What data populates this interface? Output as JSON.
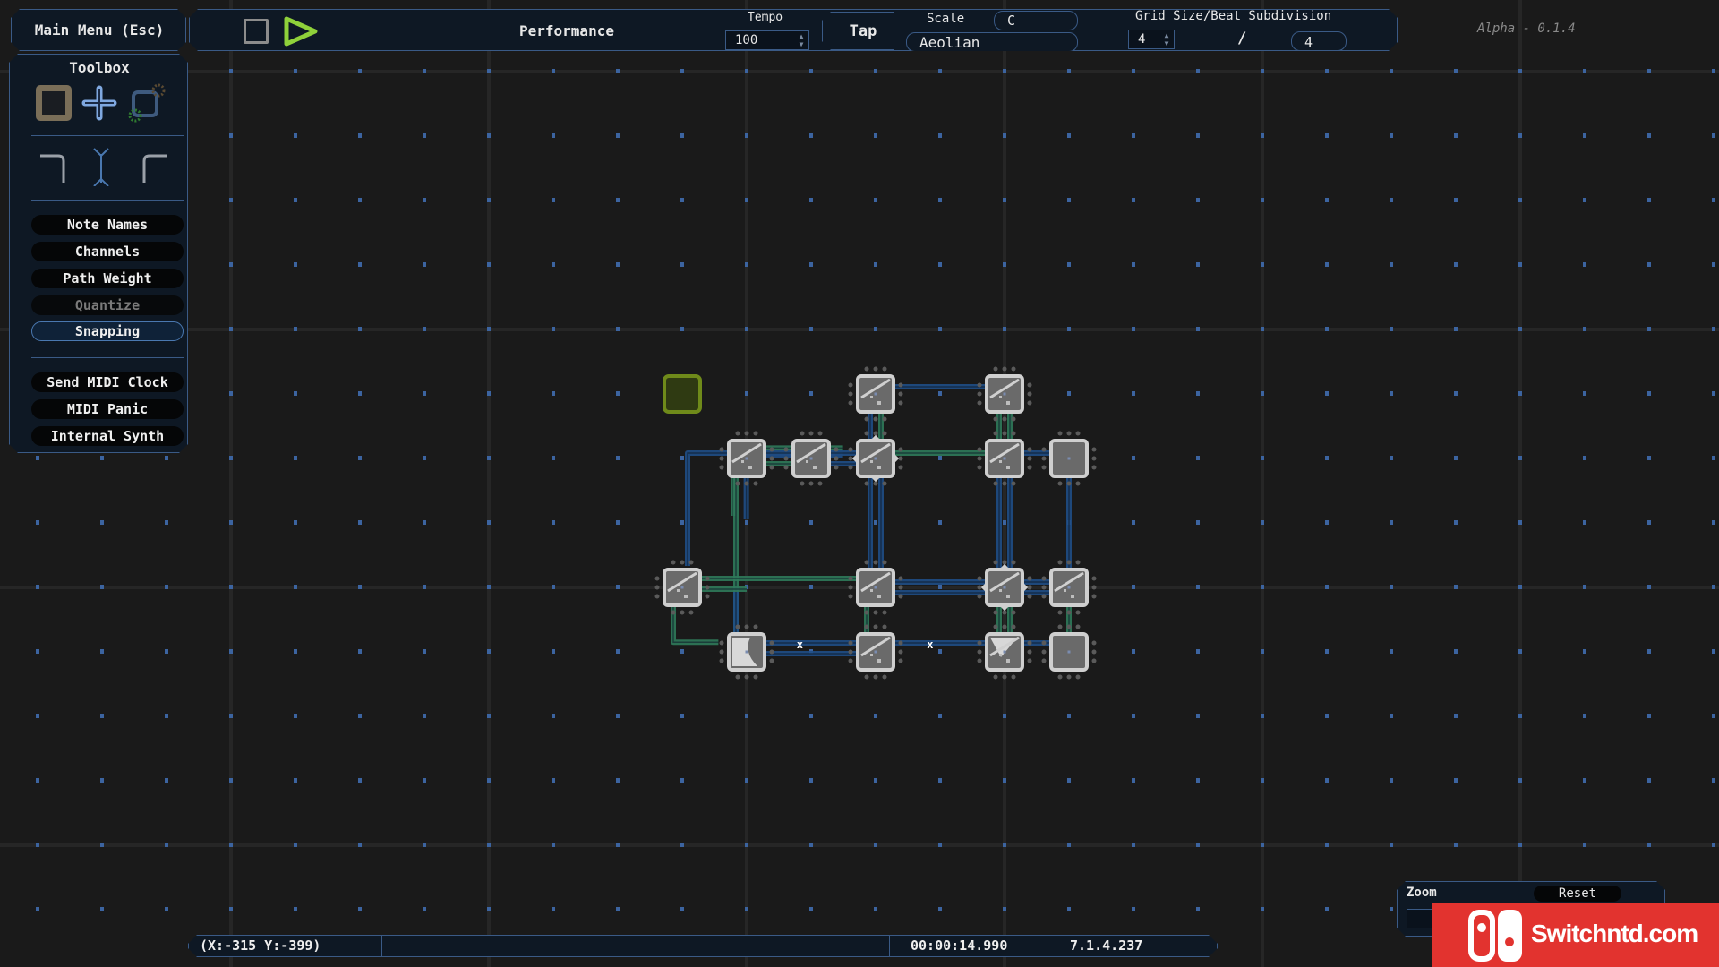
{
  "app": {
    "version_label": "Alpha - 0.1.4"
  },
  "main_menu": {
    "label": "Main Menu (Esc)"
  },
  "toolbar": {
    "stop_icon": "stop-square-icon",
    "play_icon": "play-triangle-icon",
    "mode_label": "Performance",
    "tempo": {
      "label": "Tempo",
      "value": "100"
    },
    "tap_label": "Tap",
    "scale": {
      "label": "Scale",
      "root": "C",
      "mode": "Aeolian"
    },
    "grid": {
      "label": "Grid Size/Beat Subdivision",
      "size": "4",
      "divider": "/",
      "subdivision": "4"
    }
  },
  "toolbox": {
    "title": "Toolbox",
    "tools": [
      {
        "name": "node-tool-icon"
      },
      {
        "name": "path-tool-icon"
      },
      {
        "name": "select-tool-icon"
      }
    ],
    "path_shapes": [
      {
        "name": "turn-left-path-icon"
      },
      {
        "name": "straight-path-icon"
      },
      {
        "name": "turn-right-path-icon"
      }
    ],
    "toggles": [
      {
        "label": "Note Names",
        "state": "normal"
      },
      {
        "label": "Channels",
        "state": "normal"
      },
      {
        "label": "Path Weight",
        "state": "normal"
      },
      {
        "label": "Quantize",
        "state": "disabled"
      },
      {
        "label": "Snapping",
        "state": "active"
      }
    ],
    "actions": [
      {
        "label": "Send MIDI Clock"
      },
      {
        "label": "MIDI Panic"
      },
      {
        "label": "Internal Synth"
      }
    ]
  },
  "status_bar": {
    "cursor": "(X:-315 Y:-399)",
    "elapsed": "00:00:14.990",
    "position": "7.1.4.237"
  },
  "zoom_panel": {
    "label": "Zoom",
    "reset_label": "Reset"
  },
  "watermark": {
    "text": "Switchntd.com"
  },
  "colors": {
    "background": "#1a1a1a",
    "panel": "#0e1824",
    "panel_border": "#3a5a86",
    "play": "#8fd13a",
    "path_blue": "#1f4e86",
    "path_green": "#2f7a5a",
    "node_fill": "#6a6a6a",
    "node_border": "#cfcfcf",
    "selection": "#6f8a1a",
    "watermark": "#e2332f"
  }
}
